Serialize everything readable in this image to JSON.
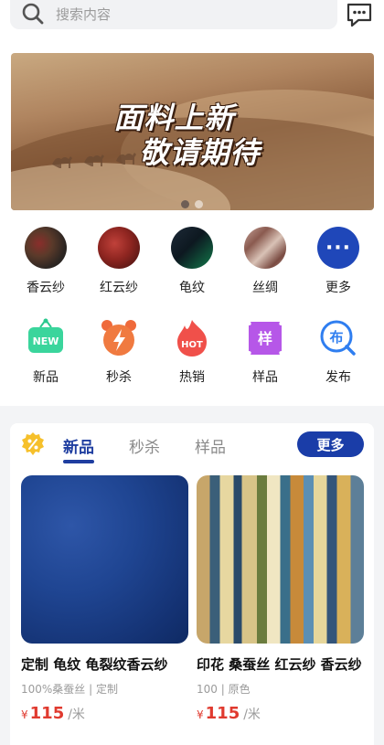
{
  "search": {
    "placeholder": "搜索内容",
    "search_icon": "search-icon",
    "chat_icon": "chat-icon"
  },
  "banner": {
    "line1": "面料上新",
    "line2": "敬请期待",
    "slide_count": 2,
    "active_slide": 1
  },
  "categories": [
    {
      "label": "香云纱"
    },
    {
      "label": "红云纱"
    },
    {
      "label": "龟纹"
    },
    {
      "label": "丝绸"
    },
    {
      "label": "更多",
      "icon": "more-icon"
    }
  ],
  "actions": [
    {
      "label": "新品",
      "icon": "new-icon",
      "badge_text": "NEW"
    },
    {
      "label": "秒杀",
      "icon": "flash-sale-icon"
    },
    {
      "label": "热销",
      "icon": "hot-icon",
      "badge_text": "HOT"
    },
    {
      "label": "样品",
      "icon": "sample-icon",
      "badge_text": "样"
    },
    {
      "label": "发布",
      "icon": "publish-icon",
      "badge_text": "布"
    }
  ],
  "section": {
    "tabs": [
      {
        "label": "新品",
        "active": true
      },
      {
        "label": "秒杀"
      },
      {
        "label": "样品"
      }
    ],
    "more_label": "更多",
    "badge_icon": "discount-icon",
    "products": [
      {
        "title": "定制 龟纹 龟裂纹香云纱",
        "subtitle": "100%桑蚕丝 | 定制",
        "currency": "¥",
        "price": "115",
        "unit": "/米"
      },
      {
        "title": "印花 桑蚕丝 红云纱 香云纱",
        "subtitle": "100 | 原色",
        "currency": "¥",
        "price": "115",
        "unit": "/米"
      }
    ]
  },
  "colors": {
    "brand_blue": "#1f3ea0",
    "price_red": "#e03a2f"
  }
}
